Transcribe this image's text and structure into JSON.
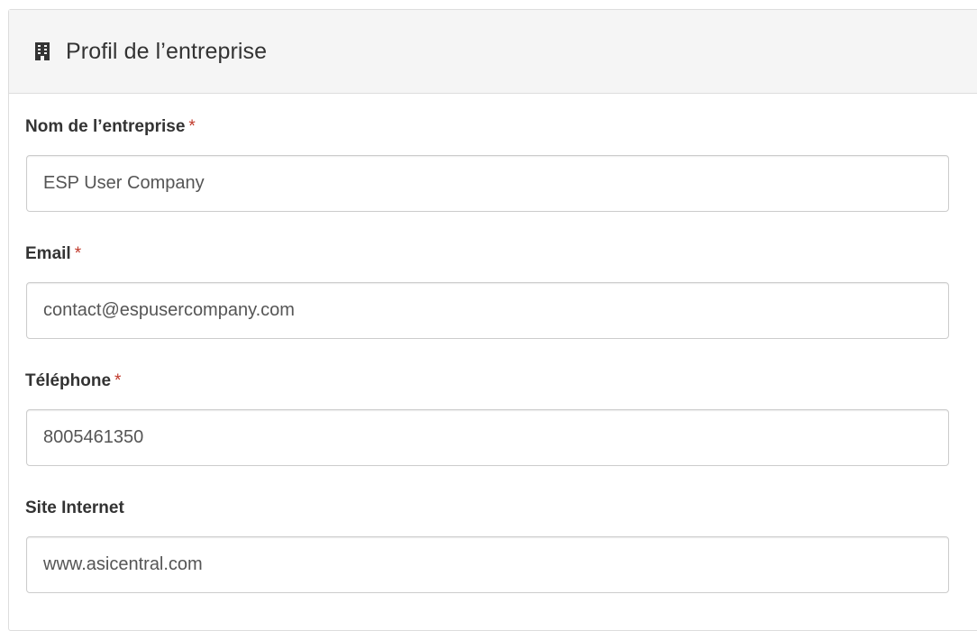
{
  "panel": {
    "title": "Profil de l’entreprise",
    "icon": "building-icon"
  },
  "form": {
    "company_name": {
      "label": "Nom de l’entreprise",
      "required_mark": "*",
      "value": "ESP User Company"
    },
    "email": {
      "label": "Email",
      "required_mark": "*",
      "value": "contact@espusercompany.com"
    },
    "phone": {
      "label": "Téléphone",
      "required_mark": "*",
      "value": "8005461350"
    },
    "website": {
      "label": "Site Internet",
      "value": "www.asicentral.com"
    }
  },
  "colors": {
    "heading_bg": "#f5f5f5",
    "border": "#dddddd",
    "required": "#c0392b",
    "text": "#333333",
    "input_text": "#555555"
  }
}
